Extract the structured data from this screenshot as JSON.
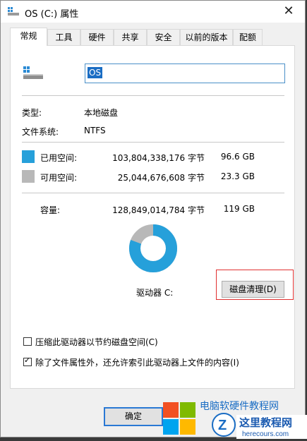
{
  "window": {
    "title": "OS (C:) 属性",
    "close": "✕"
  },
  "tabs": [
    "常规",
    "工具",
    "硬件",
    "共享",
    "安全",
    "以前的版本",
    "配额"
  ],
  "drive": {
    "name": "OS"
  },
  "info": {
    "type_label": "类型:",
    "type_value": "本地磁盘",
    "fs_label": "文件系统:",
    "fs_value": "NTFS"
  },
  "space": {
    "used": {
      "label": "已用空间:",
      "bytes": "103,804,338,176 字节",
      "size": "96.6 GB",
      "color": "#26a0da"
    },
    "free": {
      "label": "可用空间:",
      "bytes": "25,044,676,608 字节",
      "size": "23.3 GB",
      "color": "#b8b8b8"
    },
    "capacity": {
      "label": "容量:",
      "bytes": "128,849,014,784 字节",
      "size": "119 GB"
    },
    "used_fraction": 0.806
  },
  "drive_label": "驱动器 C:",
  "cleanup_button": "磁盘清理(D)",
  "options": {
    "compress": {
      "label": "压缩此驱动器以节约磁盘空间(C)",
      "checked": false
    },
    "index": {
      "label": "除了文件属性外，还允许索引此驱动器上文件的内容(I)",
      "checked": true
    }
  },
  "ok_button": "确定",
  "watermark": {
    "text_top": "电脑软硬件教程网",
    "brand": "这里教程网",
    "domain": "herecours.com"
  }
}
